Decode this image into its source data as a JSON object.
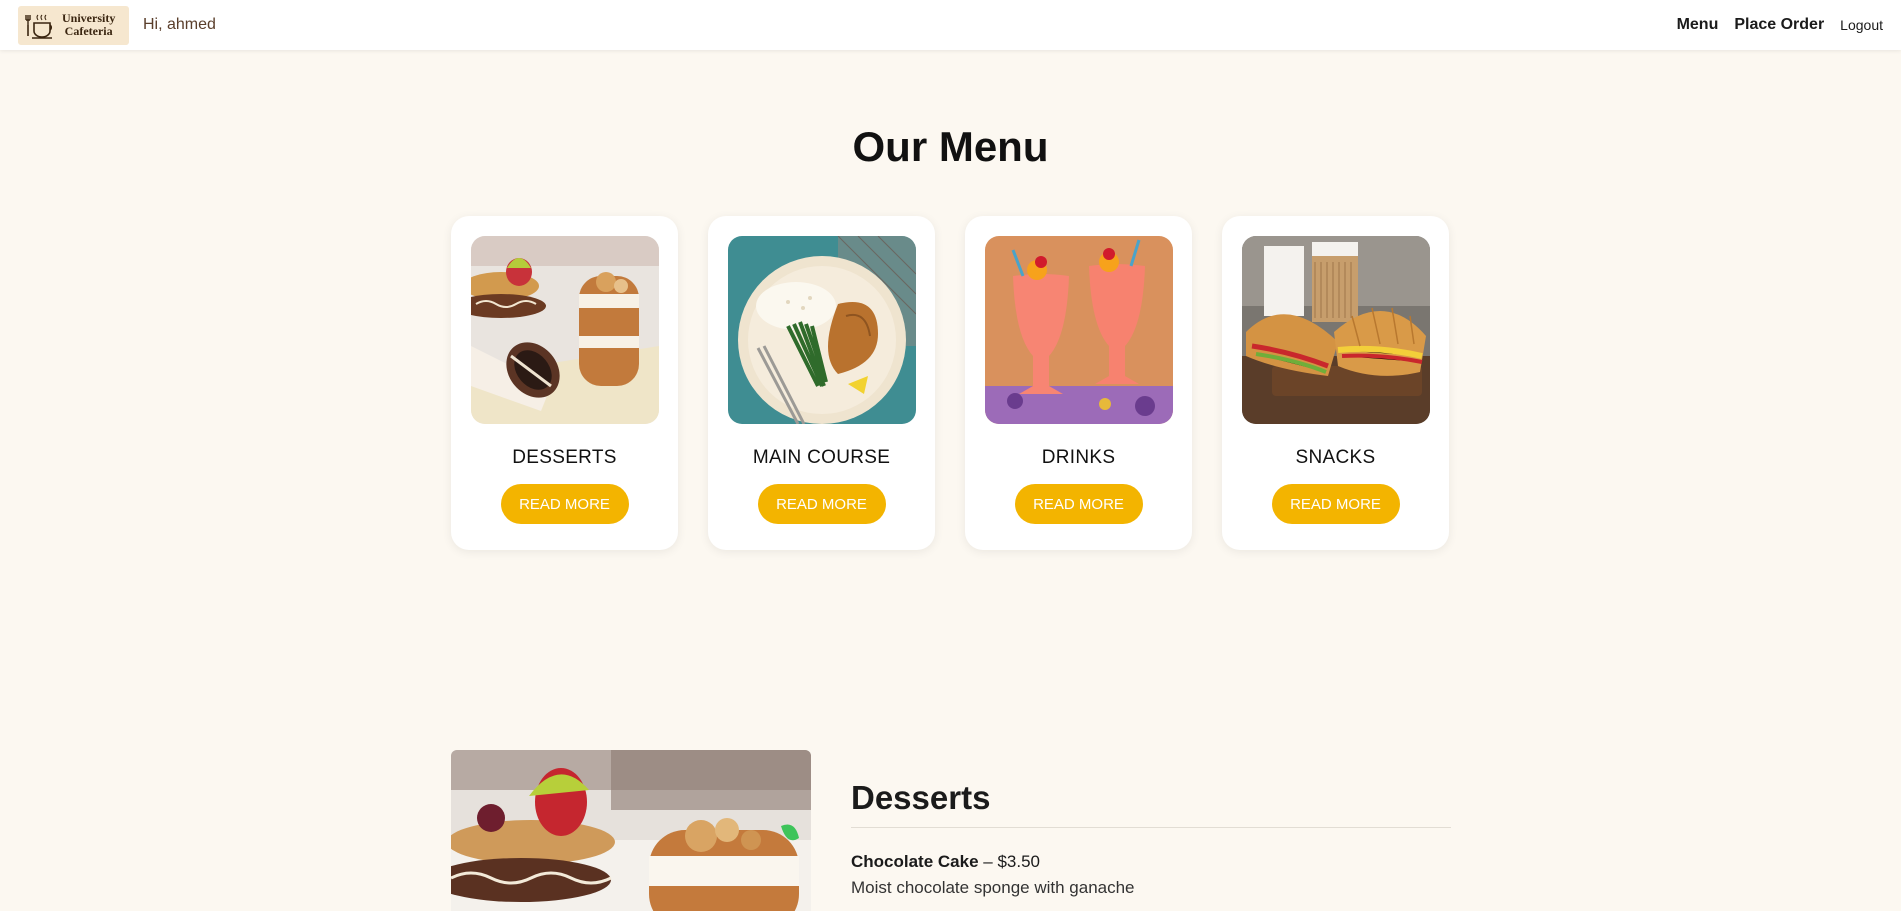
{
  "navbar": {
    "brand_line1": "University",
    "brand_line2": "Cafeteria",
    "greeting": "Hi, ahmed",
    "links": {
      "menu": "Menu",
      "place_order": "Place Order",
      "logout": "Logout"
    }
  },
  "page_title": "Our Menu",
  "categories": [
    {
      "name": "DESSERTS",
      "button": "READ MORE",
      "image": "desserts-photo"
    },
    {
      "name": "MAIN COURSE",
      "button": "READ MORE",
      "image": "main-course-photo"
    },
    {
      "name": "DRINKS",
      "button": "READ MORE",
      "image": "drinks-photo"
    },
    {
      "name": "SNACKS",
      "button": "READ MORE",
      "image": "snacks-photo"
    }
  ],
  "desserts_section": {
    "title": "Desserts",
    "items": [
      {
        "name": "Chocolate Cake",
        "separator": " – ",
        "price": "$3.50",
        "description": "Moist chocolate sponge with ganache"
      }
    ]
  },
  "colors": {
    "background": "#fcf8f1",
    "accent": "#f3b400",
    "brand_bg": "#f6e7cf"
  }
}
